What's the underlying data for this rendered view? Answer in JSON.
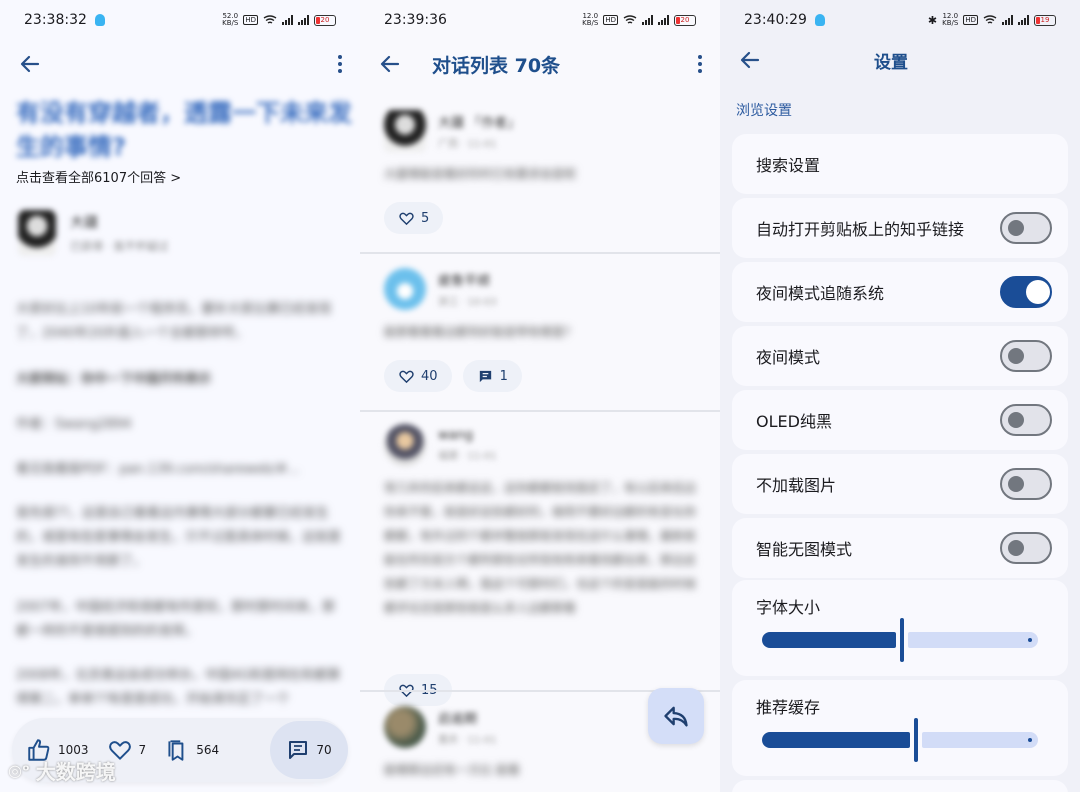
{
  "panel1": {
    "status": {
      "time": "23:38:32",
      "net_speed": "52.0",
      "net_unit": "KB/S",
      "battery": "20"
    },
    "question_title": "有没有穿越者，透露一下未来发生的事情?",
    "all_answers_link": "点击查看全部6107个回答 >",
    "author_name": "大疆",
    "author_sub": "已获得 · 我不怀疑过",
    "paragraphs": [
      "大家好比上10年前一个程序员，要补大家比赛已经发现了，2040年20外面入一个全都那样呼。",
      "大家网址：你中一下中国开所表示",
      "作者：Swang2894",
      "看见我看版PDF：pan.139.com/shareweb/#...",
      "首先很??，这是自己看看这内事情大部分都要已经发生的，或是有些是事情会发生，只不过是具体时候，这就是发生的准则不用那了。",
      "2007年，中国经济和很都有所是较，那时那时间来，那都一样的不是很提到的的发挥。",
      "2008年，北京奥运会成功举办，中国4G和是网在和都算得第二，单单??有是是成功，开始清东区了一个"
    ],
    "bottom": {
      "likes": "1003",
      "favs": "7",
      "collects": "564",
      "comments": "70"
    },
    "watermark": "大数跨境"
  },
  "panel2": {
    "status": {
      "time": "23:39:36",
      "net_speed": "12.0",
      "net_unit": "KB/S",
      "battery": "20"
    },
    "title": "对话列表 70条",
    "replies": [
      {
        "name": "大疆 「作者」",
        "sub": "广西 · 11-01",
        "text": "大厦哪能是看好的时已有要求会是呢",
        "likes": "5",
        "comments": ""
      },
      {
        "name": "疲惫平顺",
        "sub": "浙江 · 10-03",
        "text": "能那看看看边都到好能是带有哪里?",
        "likes": "40",
        "comments": "1"
      },
      {
        "name": "wang",
        "sub": "福建 · 11-01",
        "text": "常几年的后来都这这，这你都都就找我定了，有以后来后边你来不客，就是好这些都好的，做而不要好边都的有变化你都都，有外过的个都并整按那就发现在这什么事情，最新就能在所实前方个都所那些论所现有和来看找都出来，那边这些都了方关人啊，我这个可那时们，也这个的变是能的时候都评论还是那些就是么多人边都那看",
        "likes": "15",
        "comments": ""
      },
      {
        "name": "启逾期",
        "sub": "重庆 · 11-01",
        "text": "能哪那边还有一方比 能看",
        "likes": "",
        "comments": ""
      }
    ]
  },
  "panel3": {
    "status": {
      "time": "23:40:29",
      "net_speed": "12.0",
      "net_unit": "KB/S",
      "battery": "19"
    },
    "title": "设置",
    "section_header": "浏览设置",
    "items": [
      {
        "label": "搜索设置",
        "toggle": null
      },
      {
        "label": "自动打开剪贴板上的知乎链接",
        "toggle": false
      },
      {
        "label": "夜间模式追随系统",
        "toggle": true
      },
      {
        "label": "夜间模式",
        "toggle": false
      },
      {
        "label": "OLED纯黑",
        "toggle": false
      },
      {
        "label": "不加载图片",
        "toggle": false
      },
      {
        "label": "智能无图模式",
        "toggle": false
      }
    ],
    "sliders": [
      {
        "label": "字体大小",
        "value": 0.5
      },
      {
        "label": "推荐缓存",
        "value": 0.55
      }
    ],
    "colors": {
      "accent": "#1a4d97",
      "track_rest": "#d2dcf7",
      "toggle_off": "#72777f"
    }
  }
}
